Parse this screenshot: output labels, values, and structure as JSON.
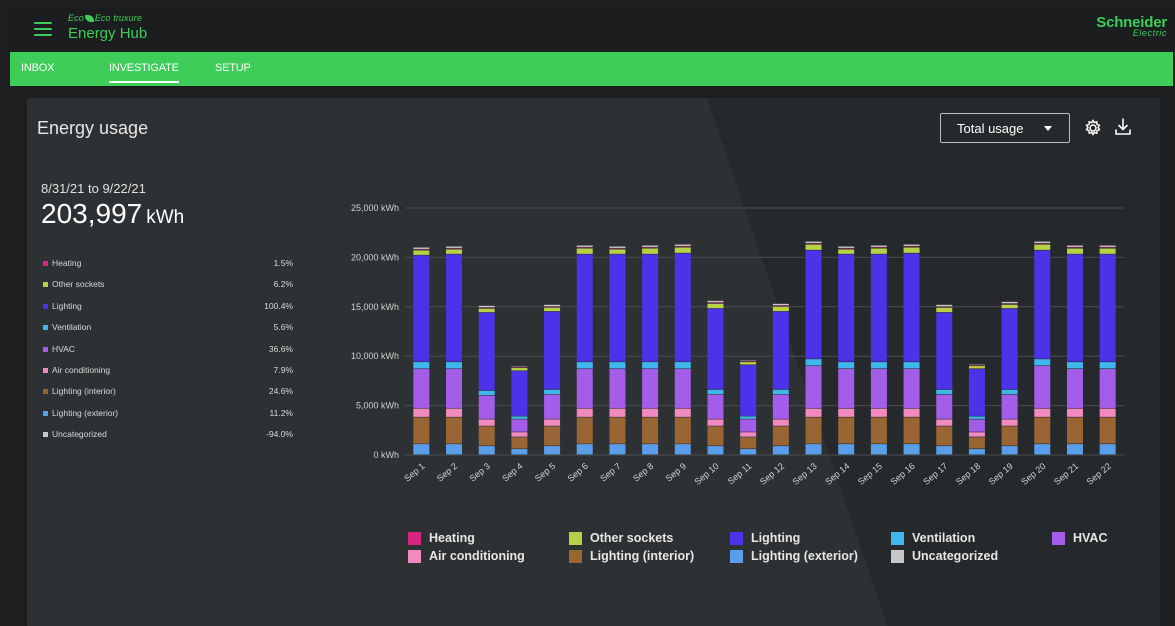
{
  "app": {
    "brand_small": "Eco truxure",
    "brand_name": "Energy Hub",
    "vendor_line1": "Schneider",
    "vendor_line2": "Electric",
    "accent_color": "#3dcd58"
  },
  "nav": {
    "tabs": [
      {
        "label": "INBOX",
        "active": false
      },
      {
        "label": "INVESTIGATE",
        "active": true
      },
      {
        "label": "SETUP",
        "active": false
      }
    ]
  },
  "panel": {
    "title": "Energy usage",
    "dropdown": {
      "selected": "Total usage"
    },
    "icons": [
      "settings-gear-icon",
      "download-icon"
    ]
  },
  "summary": {
    "date_range": "8/31/21 to 9/22/21",
    "total_value": "203,997",
    "total_unit": "kWh",
    "breakdown": [
      {
        "name": "Heating",
        "percent": "1.5%",
        "color": "#d6247f"
      },
      {
        "name": "Other sockets",
        "percent": "6.2%",
        "color": "#b8d045"
      },
      {
        "name": "Lighting",
        "percent": "100.4%",
        "color": "#4c32e8"
      },
      {
        "name": "Ventilation",
        "percent": "5.6%",
        "color": "#3fb6ec"
      },
      {
        "name": "HVAC",
        "percent": "36.6%",
        "color": "#a45de8"
      },
      {
        "name": "Air conditioning",
        "percent": "7.9%",
        "color": "#f08ac0"
      },
      {
        "name": "Lighting (interior)",
        "percent": "24.6%",
        "color": "#9a6535"
      },
      {
        "name": "Lighting (exterior)",
        "percent": "11.2%",
        "color": "#5a9de8"
      },
      {
        "name": "Uncategorized",
        "percent": "-94.0%",
        "color": "#c8c8c8"
      }
    ]
  },
  "chart_data": {
    "type": "bar",
    "stacked": true,
    "categories": [
      "Sep 1",
      "Sep 2",
      "Sep 3",
      "Sep 4",
      "Sep 5",
      "Sep 6",
      "Sep 7",
      "Sep 8",
      "Sep 9",
      "Sep 10",
      "Sep 11",
      "Sep 12",
      "Sep 13",
      "Sep 14",
      "Sep 15",
      "Sep 16",
      "Sep 17",
      "Sep 18",
      "Sep 19",
      "Sep 20",
      "Sep 21",
      "Sep 22"
    ],
    "ylim": [
      0,
      25000
    ],
    "yticks": [
      0,
      5000,
      10000,
      15000,
      20000,
      25000
    ],
    "ytick_labels": [
      "0 kWh",
      "5,000 kWh",
      "10,000 kWh",
      "15,000 kWh",
      "20,000 kWh",
      "25,000 kWh"
    ],
    "grid": true,
    "legend_position": "bottom",
    "series": [
      {
        "name": "Lighting (exterior)",
        "color": "#5a9de8",
        "values": [
          1100,
          1100,
          900,
          600,
          900,
          1100,
          1100,
          1100,
          1100,
          900,
          600,
          900,
          1100,
          1100,
          1100,
          1100,
          900,
          600,
          900,
          1100,
          1100,
          1100
        ]
      },
      {
        "name": "Lighting (interior)",
        "color": "#9a6535",
        "values": [
          2700,
          2700,
          2000,
          1200,
          2000,
          2700,
          2700,
          2700,
          2700,
          2000,
          1200,
          2000,
          2700,
          2700,
          2700,
          2700,
          2000,
          1200,
          2000,
          2700,
          2700,
          2700
        ]
      },
      {
        "name": "Air conditioning",
        "color": "#f08ac0",
        "values": [
          900,
          900,
          700,
          500,
          700,
          900,
          900,
          900,
          900,
          700,
          500,
          700,
          900,
          900,
          900,
          900,
          700,
          500,
          700,
          900,
          900,
          900
        ]
      },
      {
        "name": "HVAC",
        "color": "#a45de8",
        "values": [
          4000,
          4000,
          2400,
          1300,
          2500,
          4000,
          4000,
          4000,
          4000,
          2500,
          1300,
          2500,
          4300,
          4000,
          4000,
          4000,
          2500,
          1300,
          2500,
          4300,
          4000,
          4000
        ]
      },
      {
        "name": "Ventilation",
        "color": "#3fb6ec",
        "values": [
          700,
          700,
          500,
          300,
          500,
          700,
          700,
          700,
          700,
          500,
          300,
          500,
          700,
          700,
          700,
          700,
          500,
          300,
          500,
          700,
          700,
          700
        ]
      },
      {
        "name": "Lighting",
        "color": "#4c32e8",
        "values": [
          10800,
          10900,
          7900,
          4600,
          7900,
          10900,
          10900,
          10900,
          11000,
          8200,
          5200,
          7900,
          11000,
          10900,
          10900,
          11000,
          7800,
          4800,
          8200,
          11000,
          10900,
          10900
        ]
      },
      {
        "name": "Other sockets",
        "color": "#b8d045",
        "values": [
          500,
          500,
          400,
          300,
          400,
          600,
          500,
          600,
          600,
          500,
          300,
          500,
          600,
          500,
          600,
          600,
          500,
          300,
          400,
          600,
          600,
          600
        ]
      },
      {
        "name": "Heating",
        "color": "#d6247f",
        "values": [
          100,
          100,
          100,
          100,
          100,
          100,
          100,
          100,
          100,
          100,
          100,
          100,
          100,
          100,
          100,
          100,
          100,
          100,
          100,
          100,
          100,
          100
        ]
      },
      {
        "name": "Uncategorized",
        "color": "#c8c8c8",
        "values": [
          200,
          200,
          200,
          100,
          200,
          200,
          200,
          200,
          200,
          200,
          100,
          200,
          200,
          200,
          200,
          200,
          200,
          100,
          200,
          200,
          200,
          200
        ]
      }
    ],
    "legend": [
      {
        "name": "Heating",
        "color": "#d6247f"
      },
      {
        "name": "Other sockets",
        "color": "#b8d045"
      },
      {
        "name": "Lighting",
        "color": "#4c32e8"
      },
      {
        "name": "Ventilation",
        "color": "#3fb6ec"
      },
      {
        "name": "HVAC",
        "color": "#a45de8"
      },
      {
        "name": "Air conditioning",
        "color": "#f08ac0"
      },
      {
        "name": "Lighting (interior)",
        "color": "#9a6535"
      },
      {
        "name": "Lighting (exterior)",
        "color": "#5a9de8"
      },
      {
        "name": "Uncategorized",
        "color": "#c8c8c8"
      }
    ]
  }
}
